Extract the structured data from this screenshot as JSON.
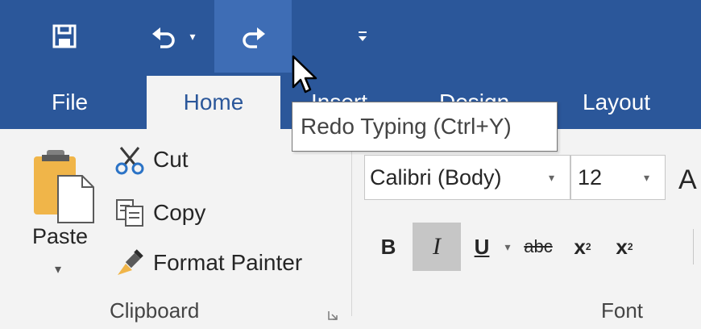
{
  "quick_access": {
    "save_icon": "save-icon",
    "undo_icon": "undo-icon",
    "undo_dropdown_icon": "chevron-down-icon",
    "redo_icon": "redo-icon",
    "customize_icon": "customize-qat-icon"
  },
  "tabs": [
    {
      "label": "File"
    },
    {
      "label": "Home",
      "active": true
    },
    {
      "label": "Insert"
    },
    {
      "label": "Design"
    },
    {
      "label": "Layout"
    }
  ],
  "tooltip": {
    "text": "Redo Typing (Ctrl+Y)"
  },
  "clipboard": {
    "paste_label": "Paste",
    "paste_arrow": "▾",
    "cut_label": "Cut",
    "copy_label": "Copy",
    "format_painter_label": "Format Painter",
    "group_label": "Clipboard"
  },
  "font": {
    "font_name": "Calibri (Body)",
    "font_size": "12",
    "dropdown_arrow": "▾",
    "grow_glyph": "A",
    "bold": "B",
    "italic": "I",
    "underline": "U",
    "strikethrough": "abc",
    "subscript": "x",
    "subscript_mark": "2",
    "superscript": "x",
    "superscript_mark": "2",
    "group_label": "Font"
  },
  "colors": {
    "title_blue": "#2b579a",
    "redo_hover": "#3e6db5",
    "ribbon_bg": "#f3f3f3"
  }
}
